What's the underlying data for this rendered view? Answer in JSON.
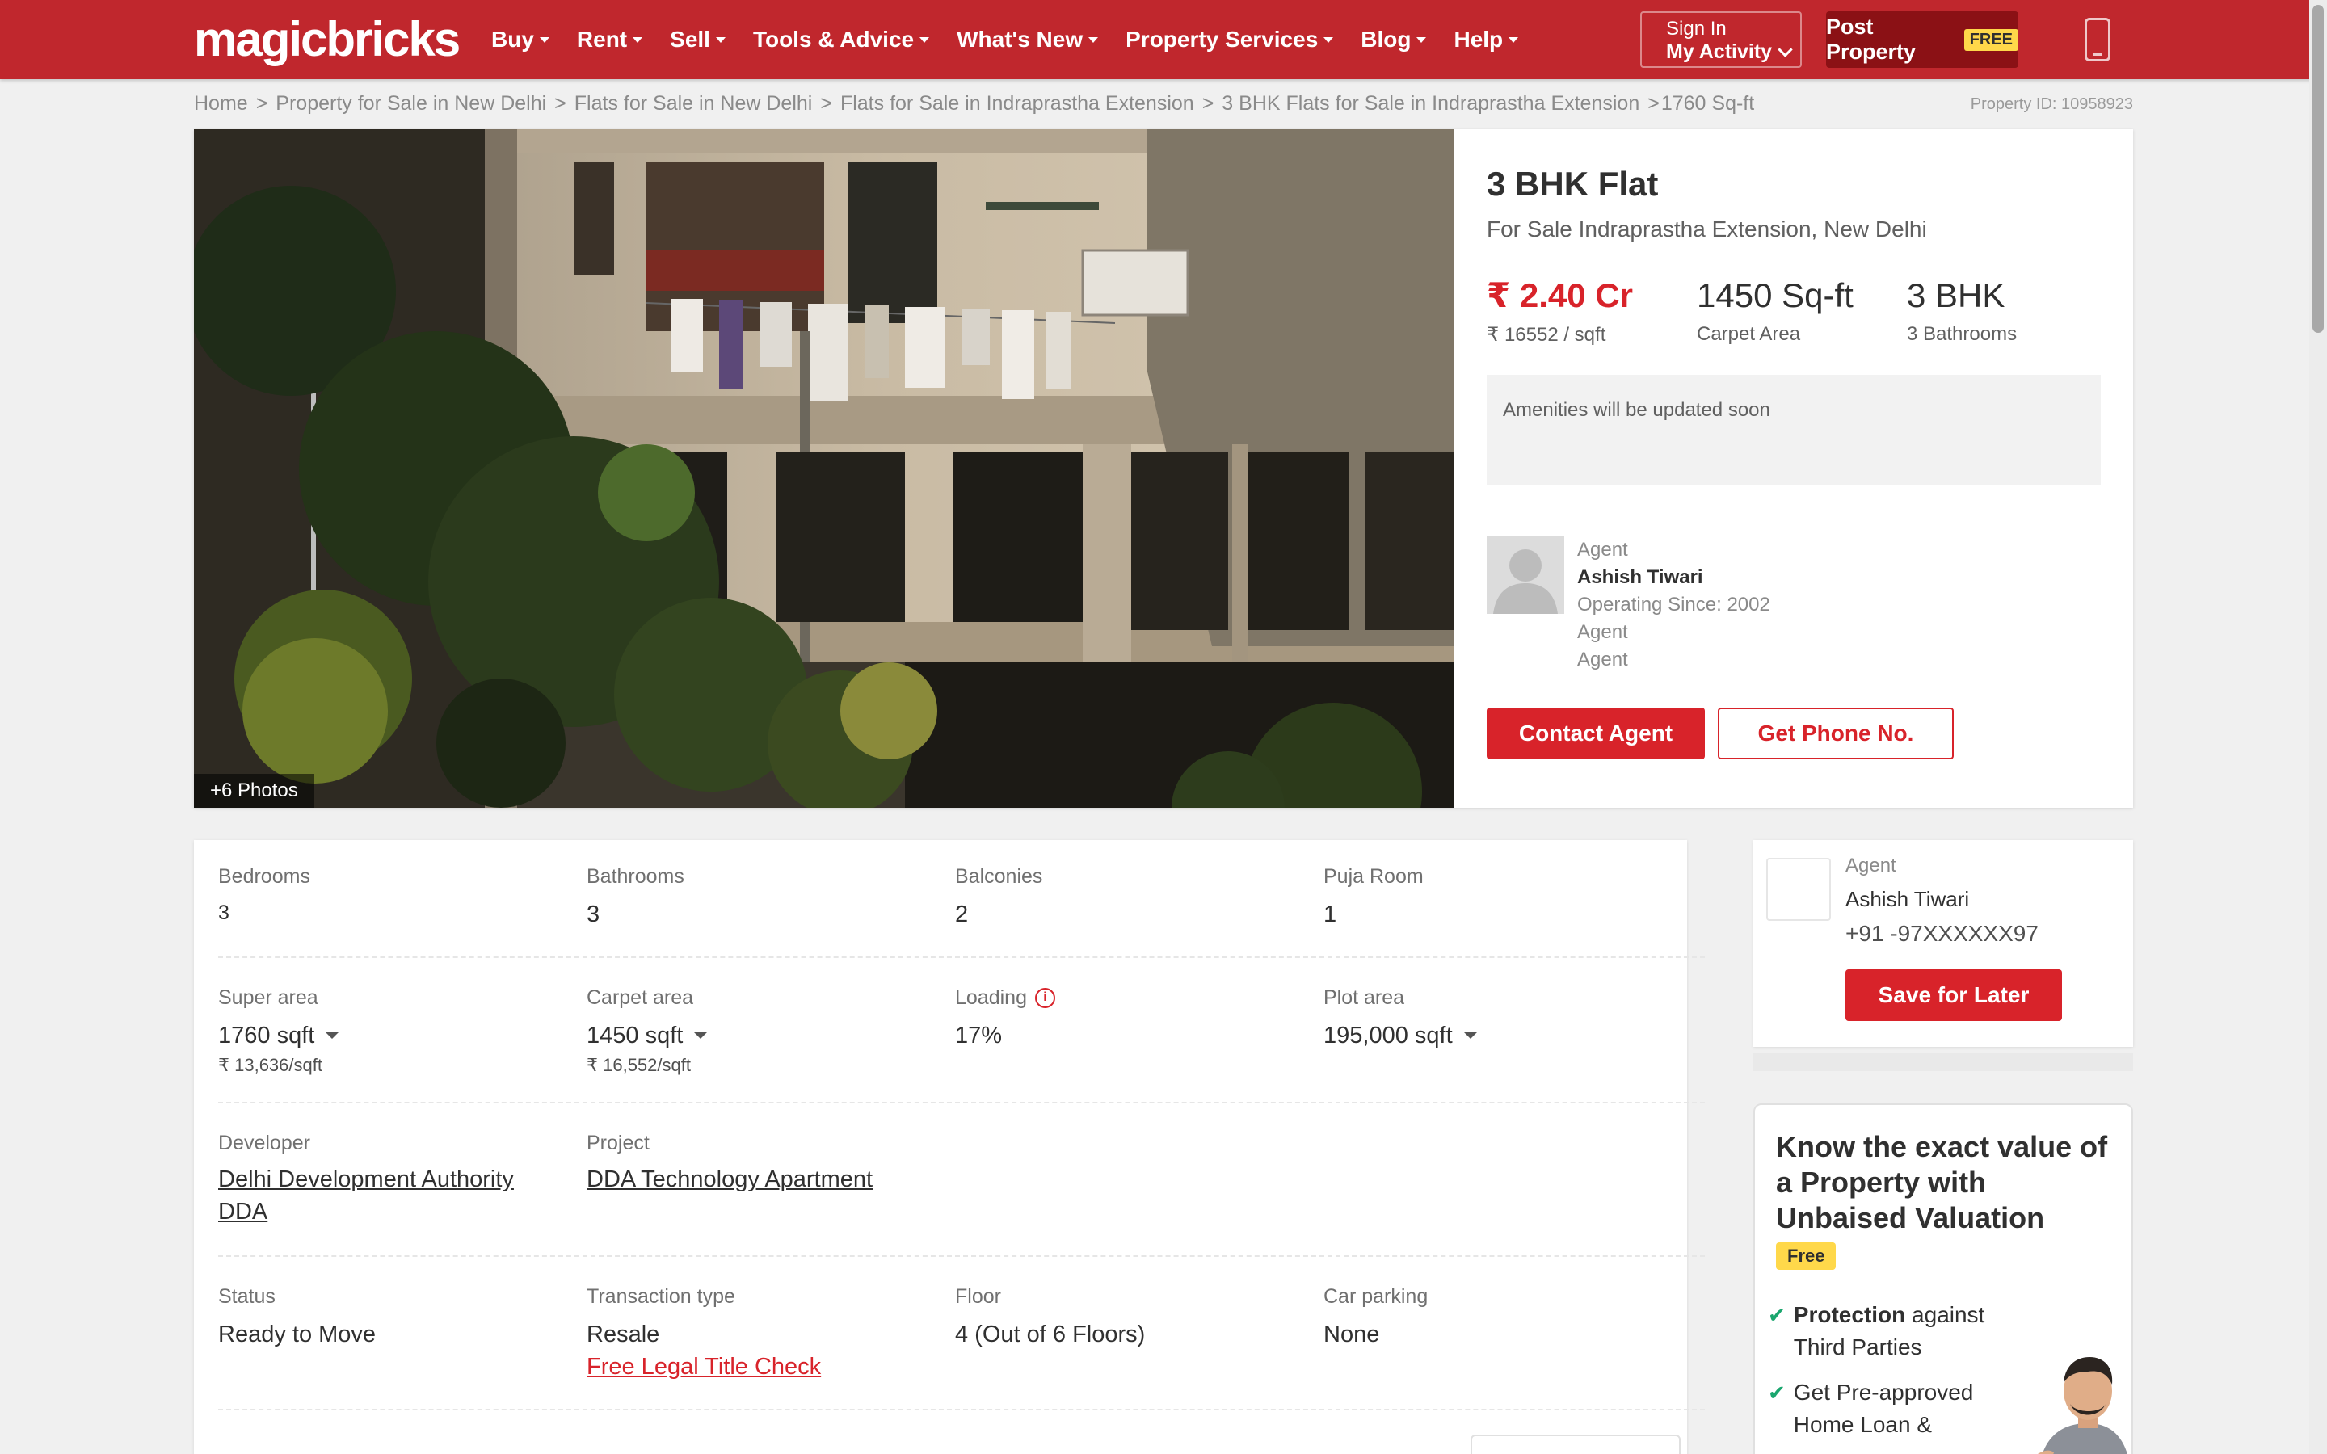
{
  "header": {
    "logo": "magicbricks",
    "nav": [
      {
        "label": "Buy"
      },
      {
        "label": "Rent"
      },
      {
        "label": "Sell"
      },
      {
        "label": "Tools & Advice"
      },
      {
        "label": "What's New"
      },
      {
        "label": "Property Services"
      },
      {
        "label": "Blog"
      },
      {
        "label": "Help"
      }
    ],
    "signin": {
      "line1": "Sign In",
      "line2": "My Activity"
    },
    "post_property": {
      "label": "Post Property",
      "tag": "FREE"
    }
  },
  "breadcrumb": {
    "items": [
      "Home",
      "Property for Sale in New Delhi",
      "Flats for Sale in New Delhi",
      "Flats for Sale in Indraprastha Extension",
      "3 BHK Flats for Sale in Indraprastha Extension"
    ],
    "last": "1760 Sq-ft",
    "property_id": "Property ID: 10958923"
  },
  "hero": {
    "photo_count": "+6 Photos",
    "title": "3 BHK Flat",
    "subtitle": "For Sale Indraprastha Extension, New Delhi",
    "price": "₹ 2.40 Cr",
    "price_per_sqft": "₹ 16552 / sqft",
    "carpet_area": "1450 Sq-ft",
    "carpet_area_label": "Carpet Area",
    "bhk": "3 BHK",
    "bathrooms_label": "3 Bathrooms",
    "amenities_text": "Amenities will be updated soon",
    "agent": {
      "role": "Agent",
      "name": "Ashish Tiwari",
      "since": "Operating Since: 2002",
      "line4": "Agent",
      "line5": "Agent"
    },
    "contact_button": "Contact Agent",
    "phone_button": "Get Phone No."
  },
  "details": {
    "row1": [
      {
        "label": "Bedrooms",
        "value": "3"
      },
      {
        "label": "Bathrooms",
        "value": "3"
      },
      {
        "label": "Balconies",
        "value": "2"
      },
      {
        "label": "Puja Room",
        "value": "1"
      }
    ],
    "row2": [
      {
        "label": "Super area",
        "value": "1760 sqft",
        "sub": "₹ 13,636/sqft"
      },
      {
        "label": "Carpet area",
        "value": "1450 sqft",
        "sub": "₹ 16,552/sqft"
      },
      {
        "label": "Loading",
        "value": "17%"
      },
      {
        "label": "Plot area",
        "value": "195,000 sqft"
      }
    ],
    "row3": [
      {
        "label": "Developer",
        "value": "Delhi Development Authority DDA"
      },
      {
        "label": "Project",
        "value": "DDA Technology Apartment"
      }
    ],
    "row4": [
      {
        "label": "Status",
        "value": "Ready to Move"
      },
      {
        "label": "Transaction type",
        "value": "Resale",
        "link": "Free Legal Title Check"
      },
      {
        "label": "Floor",
        "value": "4 (Out of 6 Floors)"
      },
      {
        "label": "Car parking",
        "value": "None"
      }
    ]
  },
  "sidebar": {
    "agent_role": "Agent",
    "agent_name": "Ashish Tiwari",
    "agent_phone": "+91 -97XXXXXX97",
    "save_button": "Save for Later",
    "valuation": {
      "title": "Know the exact value of a Property with Unbaised Valuation",
      "tag": "Free",
      "point1_bold": "Protection",
      "point1_rest": " against Third Parties",
      "point2": "Get Pre-approved Home Loan &"
    }
  },
  "colors": {
    "brand_red": "#c0272d",
    "button_red": "#d8232a",
    "post_btn": "#8b1115",
    "free_tag": "#ffd84a",
    "check_green": "#1aa66e"
  },
  "icons": [
    "caret-down-icon",
    "chevron-down-icon",
    "mobile-phone-icon",
    "info-icon",
    "check-icon",
    "agent-avatar-icon"
  ]
}
